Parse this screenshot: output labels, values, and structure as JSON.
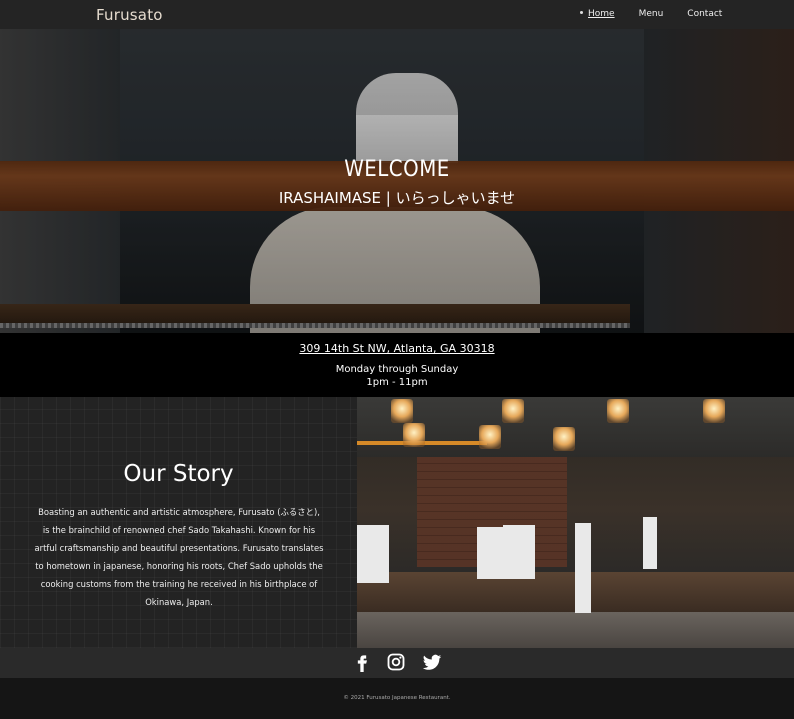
{
  "nav": {
    "brand": "Furusato",
    "links": [
      "Home",
      "Menu",
      "Contact"
    ],
    "active": "Home"
  },
  "hero": {
    "title": "WELCOME",
    "subtitle": "IRASHAIMASE | いらっしゃいませ"
  },
  "info": {
    "address": "309 14th St NW, Atlanta, GA 30318",
    "days": "Monday through Sunday",
    "hours": "1pm - 11pm"
  },
  "story": {
    "title": "Our Story",
    "text": "Boasting an authentic and artistic atmosphere, Furusato (ふるさと), is the brainchild of renowned chef Sado Takahashi. Known for his artful craftsmanship and beautiful presentations. Furusato translates to hometown in japanese, honoring his roots, Chef Sado upholds the cooking customs from the training he received in his birthplace of Okinawa, Japan."
  },
  "social": {
    "icons": [
      "facebook-icon",
      "instagram-icon",
      "twitter-icon"
    ]
  },
  "footer": {
    "copyright": "© 2021 Furusato Japanese Restaurant."
  },
  "colors": {
    "nav_bg": "#242424",
    "brand": "#e6dccf",
    "info_bg": "#000000",
    "footer_bg": "#151515"
  }
}
